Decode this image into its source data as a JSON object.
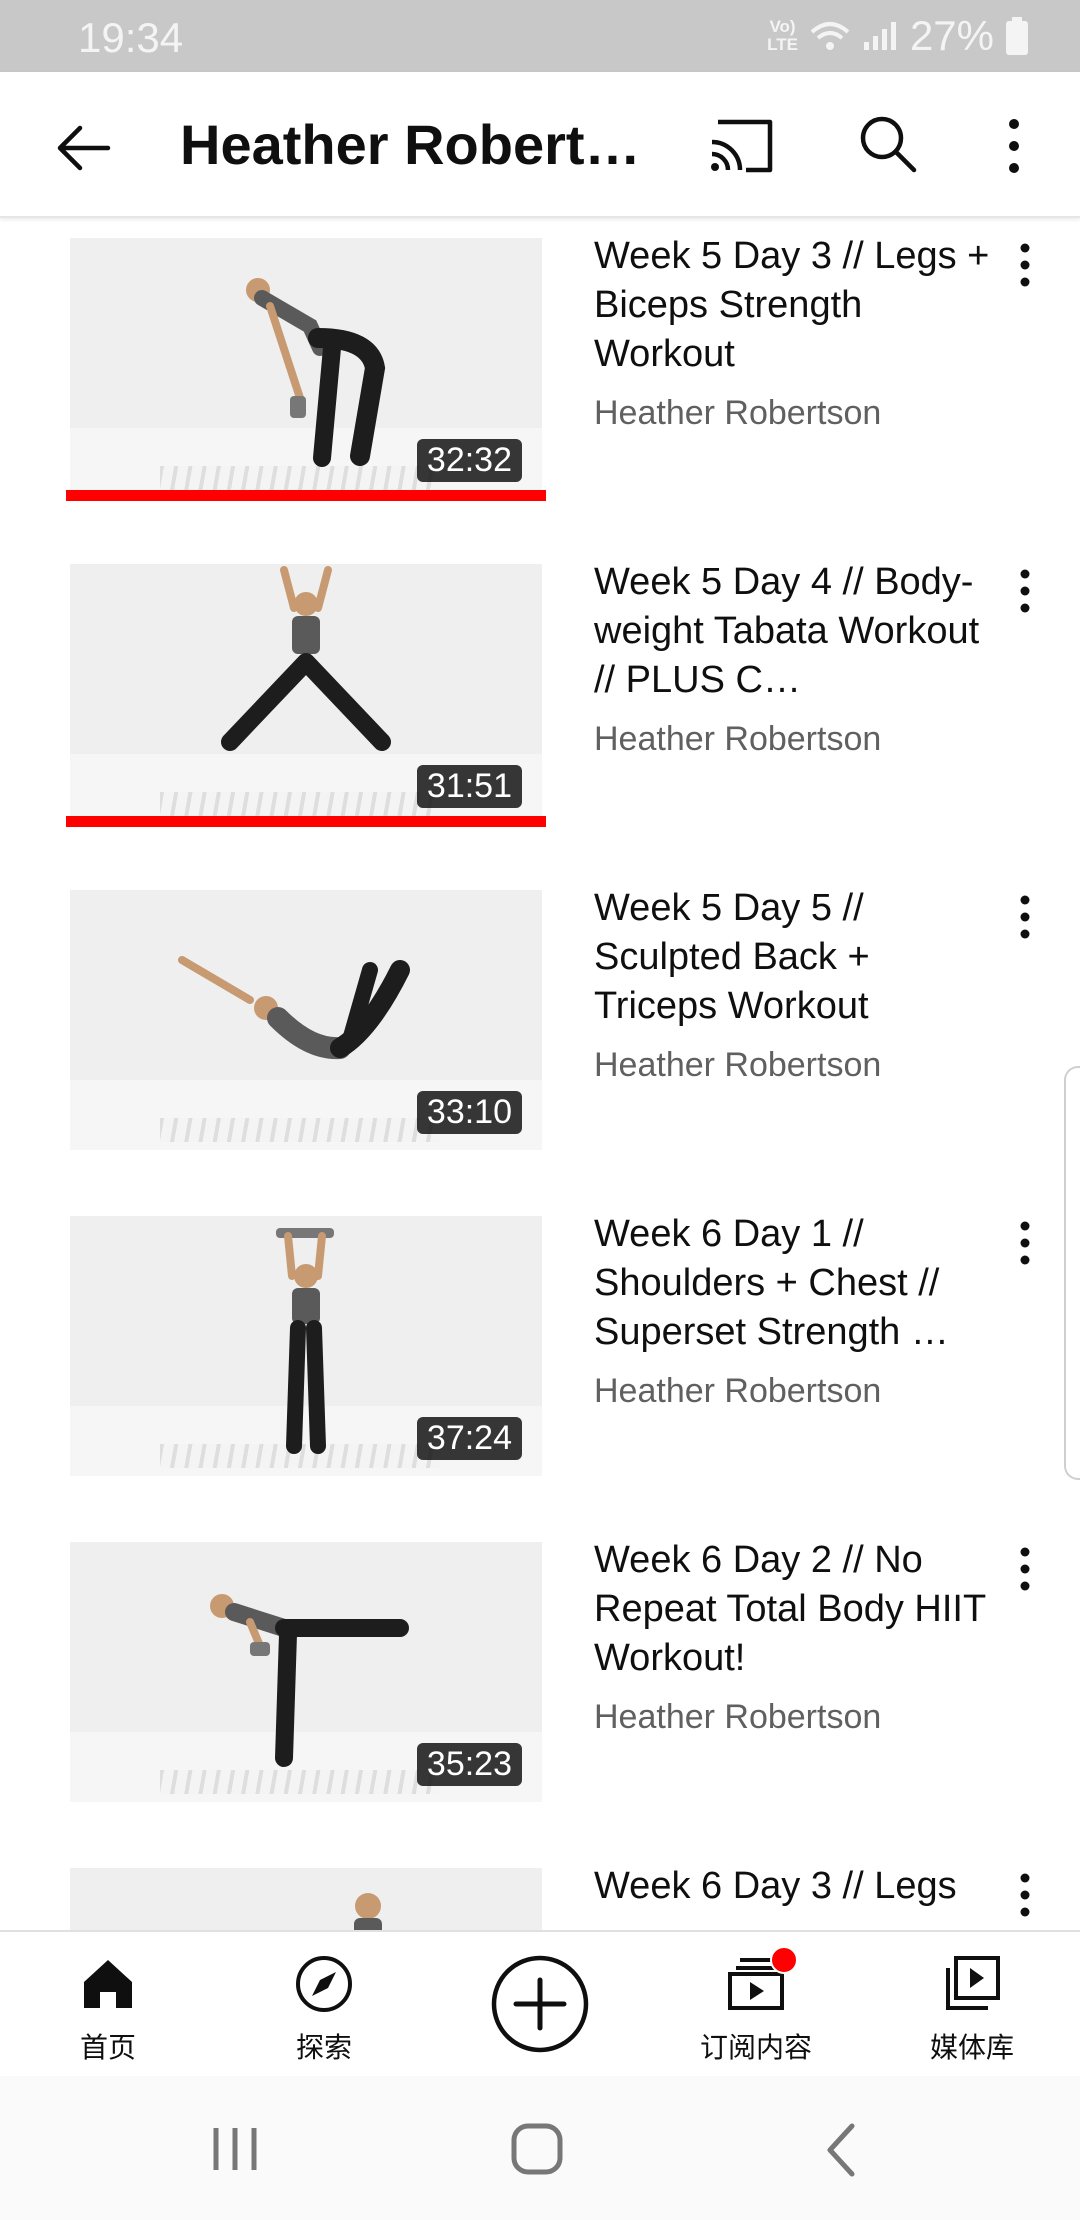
{
  "status_bar": {
    "time": "19:34",
    "network": "Vo) LTE",
    "battery": "27%"
  },
  "app_bar": {
    "title": "Heather Roberts…"
  },
  "videos": [
    {
      "title": "Week 5 Day 3 // Legs + Biceps Strength Workout",
      "channel": "Heather Robertson",
      "duration": "32:32",
      "watched": true
    },
    {
      "title": "Week 5 Day 4 // Body-weight Tabata Workout // PLUS C…",
      "channel": "Heather Robertson",
      "duration": "31:51",
      "watched": true
    },
    {
      "title": "Week 5 Day 5 // Sculpted Back + Triceps Workout",
      "channel": "Heather Robertson",
      "duration": "33:10",
      "watched": false
    },
    {
      "title": "Week 6 Day 1 // Shoulders + Chest // Superset Strength …",
      "channel": "Heather Robertson",
      "duration": "37:24",
      "watched": false
    },
    {
      "title": "Week 6 Day 2 // No Repeat Total Body HIIT Workout!",
      "channel": "Heather Robertson",
      "duration": "35:23",
      "watched": false
    },
    {
      "title": "Week 6 Day 3 // Legs",
      "channel": "",
      "duration": "",
      "watched": false
    }
  ],
  "bottom_nav": {
    "home": "首页",
    "explore": "探索",
    "subscriptions": "订阅内容",
    "library": "媒体库"
  },
  "colors": {
    "accent": "#ff0000",
    "text_primary": "#0f0f0f",
    "text_secondary": "#606060"
  }
}
